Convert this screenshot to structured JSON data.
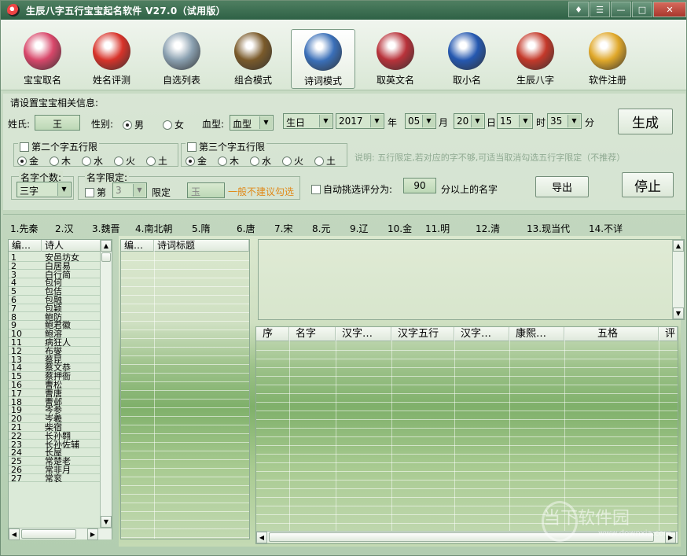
{
  "window": {
    "title": "生辰八字五行宝宝起名软件 V27.0（试用版）"
  },
  "toolbar": [
    {
      "label": "宝宝取名",
      "icon": "baby-icon",
      "color": "#d8476a"
    },
    {
      "label": "姓名评测",
      "icon": "fortune-icon",
      "color": "#d8332a"
    },
    {
      "label": "自选列表",
      "icon": "brush-pot-icon",
      "color": "#8aa0b0"
    },
    {
      "label": "组合模式",
      "icon": "warrior-icon",
      "color": "#7a5a2a"
    },
    {
      "label": "诗词模式",
      "icon": "book-disc-icon",
      "color": "#3a6fb8"
    },
    {
      "label": "取英文名",
      "icon": "football-badge-icon",
      "color": "#b8323a"
    },
    {
      "label": "取小名",
      "icon": "globe-bird-icon",
      "color": "#2558b0"
    },
    {
      "label": "生辰八字",
      "icon": "bagua-icon",
      "color": "#c4392a"
    },
    {
      "label": "软件注册",
      "icon": "lock-icon",
      "color": "#e0a82a"
    }
  ],
  "form": {
    "section_title": "请设置宝宝相关信息:",
    "surname_label": "姓氏:",
    "surname_value": "王",
    "gender_label": "性别:",
    "gender_male": "男",
    "gender_female": "女",
    "blood_label": "血型:",
    "blood_value": "血型",
    "birth_value": "生日",
    "year_value": "2017",
    "year_unit": "年",
    "month_value": "05",
    "month_unit": "月",
    "day_value": "20",
    "day_unit": "日",
    "hour_value": "15",
    "hour_unit": "时",
    "minute_value": "35",
    "minute_unit": "分",
    "generate_label": "生成",
    "stop_label": "停止",
    "export_label": "导出",
    "second_char_title": "第二个字五行限",
    "third_char_title": "第三个字五行限",
    "elements": [
      "金",
      "木",
      "水",
      "火",
      "土"
    ],
    "note": "说明: 五行限定,若对应的字不够,可适当取消勾选五行字限定（不推荐）",
    "name_count_label": "名字个数:",
    "name_count_value": "三字",
    "name_limit_label": "名字限定:",
    "limit_prefix": "第",
    "limit_pos_value": "3",
    "limit_suffix": "限定",
    "limit_char_value": "玉",
    "limit_warning": "一般不建议勾选",
    "auto_select_label": "自动挑选评分为:",
    "score_value": "90",
    "score_suffix": "分以上的名字"
  },
  "dynasties": [
    "1.先秦",
    "2.汉",
    "3.魏晋",
    "4.南北朝",
    "5.隋",
    "6.唐",
    "7.宋",
    "8.元",
    "9.辽",
    "10.金",
    "11.明",
    "12.清",
    "13.现当代",
    "14.不详"
  ],
  "poets": {
    "headers": [
      "编…",
      "诗人"
    ],
    "rows": [
      [
        "1",
        "安邑坊女"
      ],
      [
        "2",
        "白居易"
      ],
      [
        "3",
        "白行简"
      ],
      [
        "4",
        "包何"
      ],
      [
        "5",
        "包佶"
      ],
      [
        "6",
        "包融"
      ],
      [
        "7",
        "包颖"
      ],
      [
        "8",
        "鲍防"
      ],
      [
        "9",
        "鲍君徽"
      ],
      [
        "10",
        "鲍溶"
      ],
      [
        "11",
        "病狂人"
      ],
      [
        "12",
        "布燮"
      ],
      [
        "13",
        "蔡昆"
      ],
      [
        "14",
        "蔡文恭"
      ],
      [
        "15",
        "蔡押衙"
      ],
      [
        "16",
        "曹松"
      ],
      [
        "17",
        "曹唐"
      ],
      [
        "18",
        "曹邺"
      ],
      [
        "19",
        "岑参"
      ],
      [
        "20",
        "岑羲"
      ],
      [
        "21",
        "柴宿"
      ],
      [
        "22",
        "长孙翱"
      ],
      [
        "23",
        "长孙佐辅"
      ],
      [
        "24",
        "长屋"
      ],
      [
        "25",
        "常楚老"
      ],
      [
        "26",
        "常非月"
      ],
      [
        "27",
        "常衮"
      ]
    ]
  },
  "poems": {
    "headers": [
      "编…",
      "诗词标题"
    ]
  },
  "results": {
    "headers": [
      "序",
      "名字",
      "汉字…",
      "汉字五行",
      "汉字…",
      "康熙…",
      "五格",
      "评"
    ]
  },
  "watermark": {
    "main": "当下软件园",
    "sub": "www.downxia.com"
  }
}
